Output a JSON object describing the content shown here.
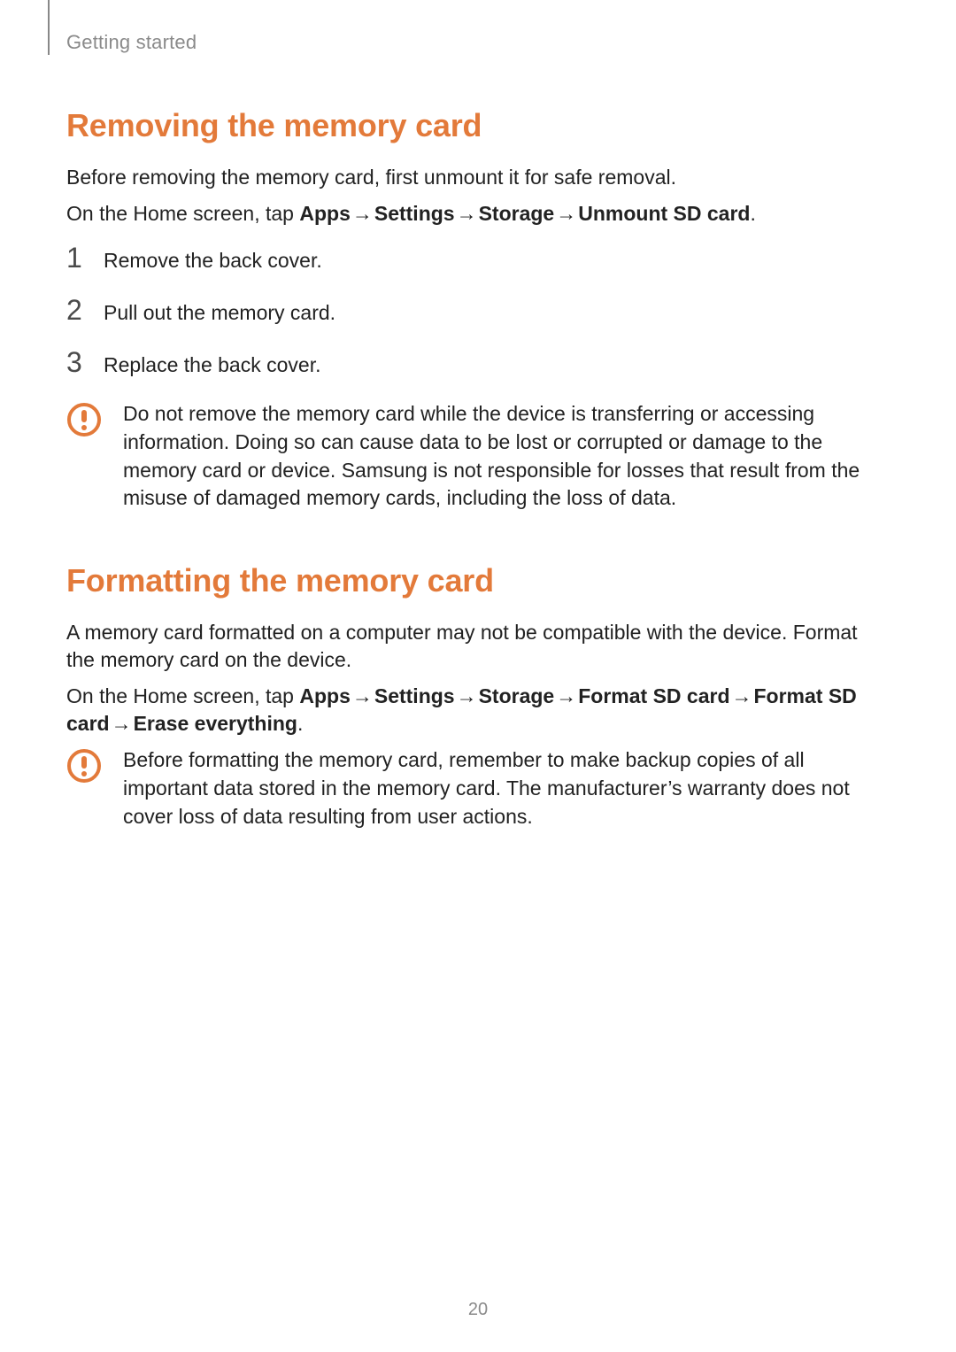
{
  "breadcrumb": "Getting started",
  "section1": {
    "heading": "Removing the memory card",
    "intro": "Before removing the memory card, first unmount it for safe removal.",
    "path_prefix": "On the Home screen, tap ",
    "path": [
      "Apps",
      "Settings",
      "Storage",
      "Unmount SD card"
    ],
    "steps": [
      "Remove the back cover.",
      "Pull out the memory card.",
      "Replace the back cover."
    ],
    "warning": "Do not remove the memory card while the device is transferring or accessing information. Doing so can cause data to be lost or corrupted or damage to the memory card or device. Samsung is not responsible for losses that result from the misuse of damaged memory cards, including the loss of data."
  },
  "section2": {
    "heading": "Formatting the memory card",
    "intro": "A memory card formatted on a computer may not be compatible with the device. Format the memory card on the device.",
    "path_prefix": "On the Home screen, tap ",
    "path": [
      "Apps",
      "Settings",
      "Storage",
      "Format SD card",
      "Format SD card",
      "Erase everything"
    ],
    "warning": "Before formatting the memory card, remember to make backup copies of all important data stored in the memory card. The manufacturer’s warranty does not cover loss of data resulting from user actions."
  },
  "arrow_glyph": "→",
  "page_number": "20",
  "colors": {
    "heading": "#e37a3a",
    "body": "#222222",
    "muted": "#8a8a8a",
    "warn": "#e37a3a"
  }
}
